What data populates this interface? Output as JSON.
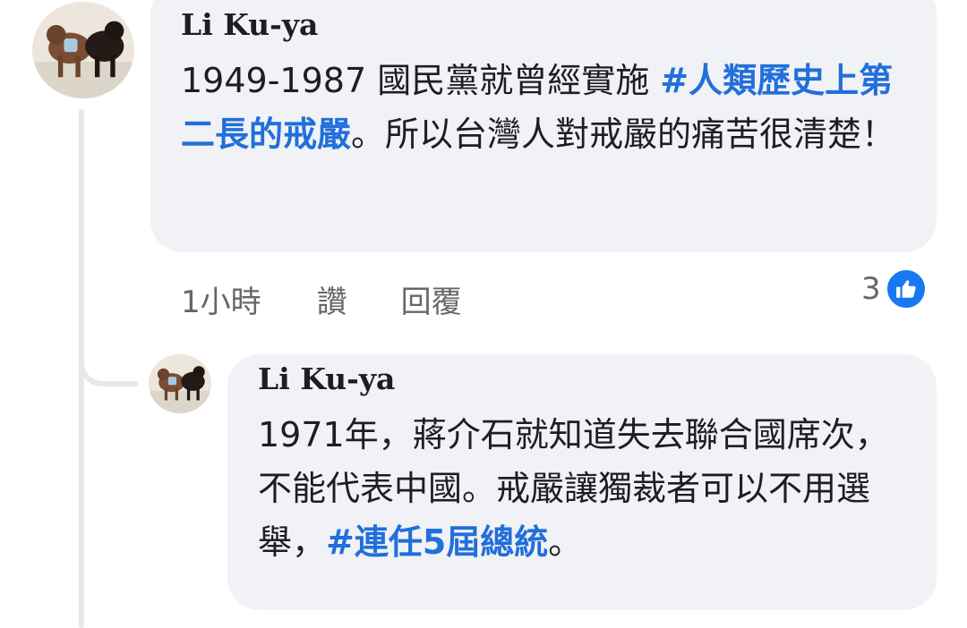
{
  "comments": [
    {
      "author": "Li Ku-ya",
      "text_parts": [
        "1949-1987 國民黨就曾經實施 ",
        "#人類歷史上第二長的戒嚴",
        "。所以台灣人對戒嚴的痛苦很清楚！"
      ],
      "time": "1小時",
      "like_label": "讚",
      "reply_label": "回覆",
      "reaction_count": "3",
      "reaction_icon": "like-icon"
    },
    {
      "author": "Li Ku-ya",
      "text_parts": [
        "1971年，蔣介石就知道失去聯合國席次，不能代表中國。戒嚴讓獨裁者可以不用選舉，",
        "#連任5屆總統",
        "。"
      ]
    }
  ],
  "colors": {
    "bubble": "#f0f2f5",
    "hashtag": "#216fdb",
    "meta_text": "#65676b",
    "like_blue": "#1877f2",
    "thread_line": "#e6e8eb"
  }
}
